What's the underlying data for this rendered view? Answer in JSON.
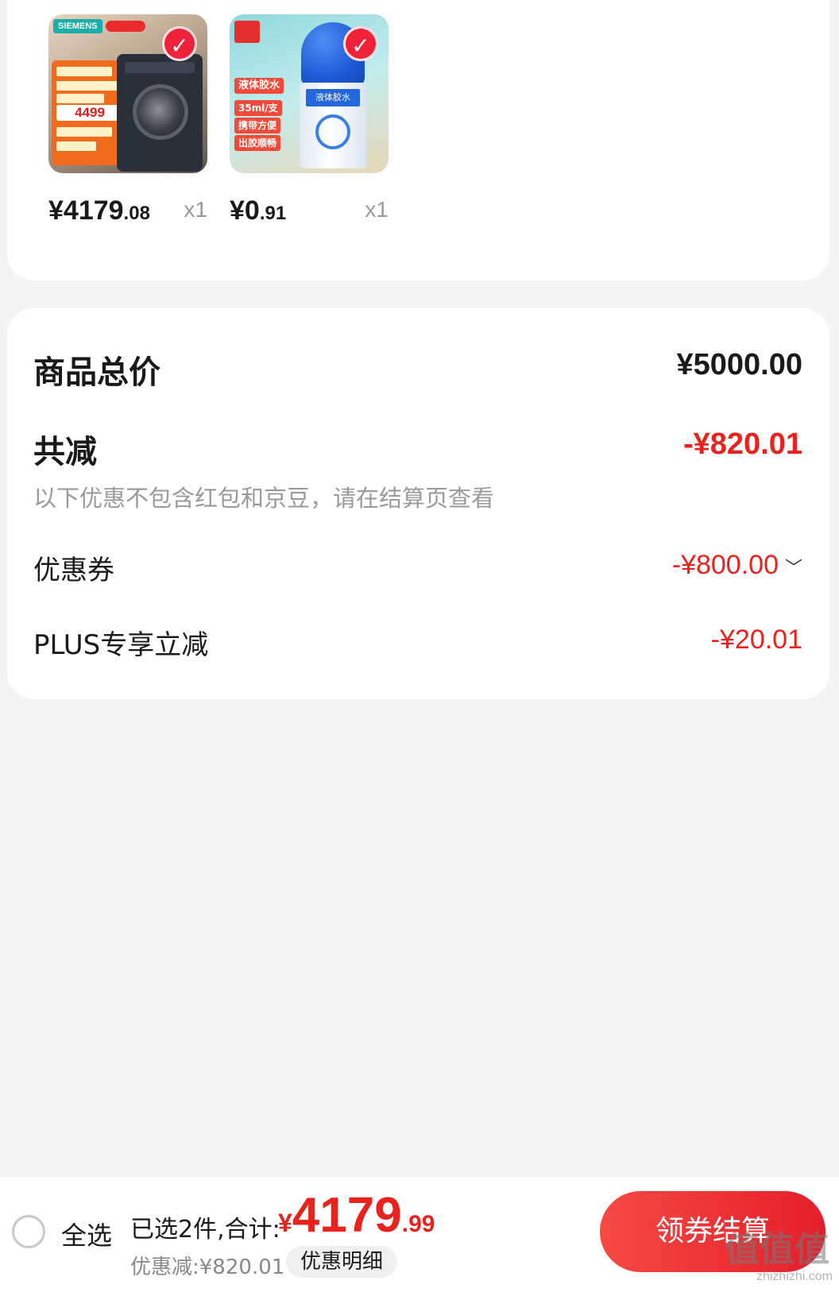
{
  "products": [
    {
      "image": "siemens-washing-machine",
      "brand": "SIEMENS",
      "promo_price": "4499",
      "price_int": "¥4179",
      "price_dec": ".08",
      "qty": "x1",
      "selected": true
    },
    {
      "image": "comix-liquid-glue",
      "labels": [
        "液体胶水",
        "35ml/支",
        "携带方便",
        "出胶顺畅"
      ],
      "bottle_label": "液体胶水",
      "price_int": "¥0",
      "price_dec": ".91",
      "qty": "x1",
      "selected": true
    }
  ],
  "summary": {
    "total_label": "商品总价",
    "total_value": "¥5000.00",
    "discount_label": "共减",
    "discount_value": "-¥820.01",
    "note": "以下优惠不包含红包和京豆，请在结算页查看",
    "coupon_label": "优惠券",
    "coupon_value": "-¥800.00",
    "plus_label": "PLUS专享立减",
    "plus_value": "-¥20.01"
  },
  "bottom_bar": {
    "select_all": "全选",
    "selected_text": "已选2件,合计:",
    "currency": "¥",
    "total_int": "4179",
    "total_dec": ".99",
    "discount_line": "优惠减:¥820.01",
    "detail_button": "优惠明细",
    "checkout_button": "领券结算"
  },
  "watermark": {
    "text": "值值值",
    "url": "zhizhizhi.com"
  },
  "colors": {
    "accent_red": "#e8231d",
    "check_red": "#f0223a",
    "background": "#f4f4f4",
    "card": "#ffffff",
    "muted_text": "#9a9a9a"
  }
}
